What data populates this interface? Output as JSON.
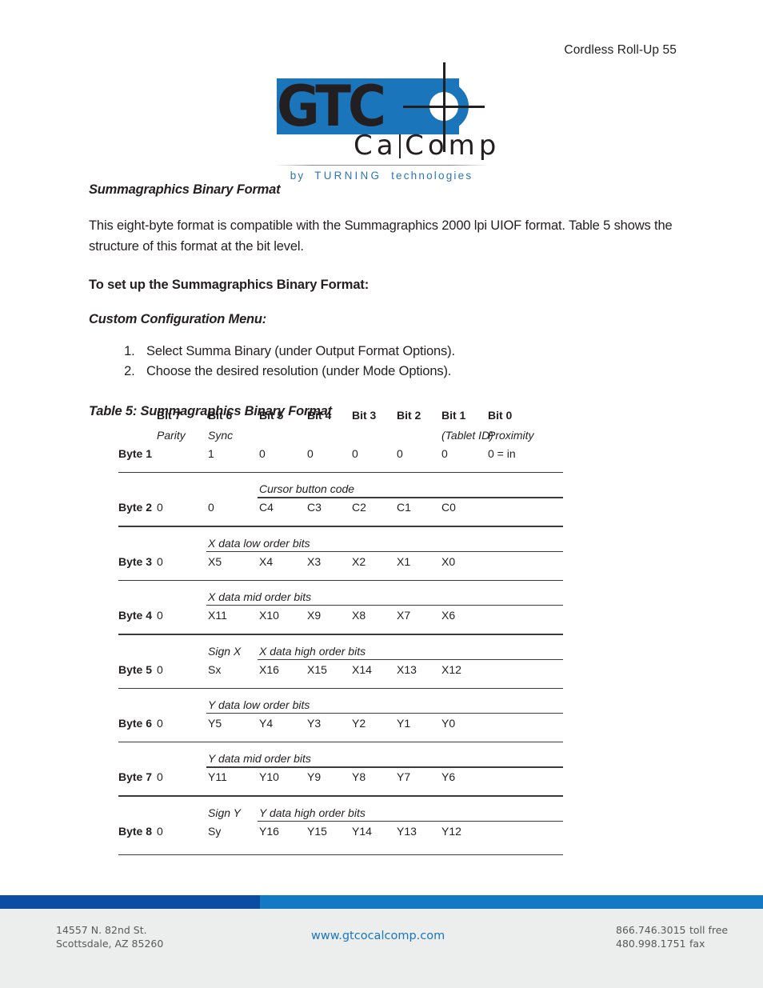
{
  "header": {
    "running_head": "Cordless Roll-Up 55"
  },
  "logo": {
    "wordmark": "GTC",
    "subwordmark_1": "Ca",
    "subwordmark_2": "Comp",
    "tagline_by": "by",
    "tagline_brand": "TURNING",
    "tagline_word": "technologies",
    "brand_blue": "#1b75bb",
    "tagline_blue": "#2e75b6"
  },
  "content": {
    "section_heading": "Summagraphics Binary Format",
    "paragraph": "This eight-byte format is compatible with the Summagraphics 2000 lpi UIOF format.  Table 5 shows the structure of this format at the bit level.",
    "setup_heading": "To set up the Summagraphics Binary Format:",
    "menu_heading": "Custom Configuration Menu:",
    "steps": [
      "Select Summa Binary (under Output Format Options).",
      "Choose the desired resolution (under Mode Options)."
    ],
    "table_caption": "Table 5: Summagraphics Binary Format"
  },
  "table": {
    "columns": [
      "Bit 7",
      "Bit 6",
      "Bit 5",
      "Bit 4",
      "Bit 3",
      "Bit 2",
      "Bit 1",
      "Bit 0"
    ],
    "header_sublabels": [
      "Parity",
      "Sync",
      "",
      "",
      "",
      "",
      "(Tablet ID)",
      "Proximity"
    ],
    "rows": [
      {
        "byte": "Byte 1",
        "group_label": "",
        "values": [
          "",
          "1",
          "0",
          "0",
          "0",
          "0",
          "0",
          "0 = in"
        ]
      },
      {
        "byte": "Byte 2",
        "group_label": "Cursor button code",
        "group_start": 2,
        "values": [
          "0",
          "0",
          "C4",
          "C3",
          "C2",
          "C1",
          "C0",
          ""
        ]
      },
      {
        "byte": "Byte 3",
        "group_label": "X data low order bits",
        "group_start": 1,
        "values": [
          "0",
          "X5",
          "X4",
          "X3",
          "X2",
          "X1",
          "X0",
          ""
        ]
      },
      {
        "byte": "Byte 4",
        "group_label": "X data mid order bits",
        "group_start": 1,
        "values": [
          "0",
          "X11",
          "X10",
          "X9",
          "X8",
          "X7",
          "X6",
          ""
        ]
      },
      {
        "byte": "Byte 5",
        "group_label": "X data high order bits",
        "sign_label": "Sign X",
        "group_start": 2,
        "values": [
          "0",
          "Sx",
          "X16",
          "X15",
          "X14",
          "X13",
          "X12",
          ""
        ]
      },
      {
        "byte": "Byte 6",
        "group_label": "Y data low order bits",
        "group_start": 1,
        "values": [
          "0",
          "Y5",
          "Y4",
          "Y3",
          "Y2",
          "Y1",
          "Y0",
          ""
        ]
      },
      {
        "byte": "Byte 7",
        "group_label": "Y data mid order bits",
        "group_start": 1,
        "values": [
          "0",
          "Y11",
          "Y10",
          "Y9",
          "Y8",
          "Y7",
          "Y6",
          ""
        ]
      },
      {
        "byte": "Byte 8",
        "group_label": "Y data high order bits",
        "sign_label": "Sign Y",
        "group_start": 2,
        "values": [
          "0",
          "Sy",
          "Y16",
          "Y15",
          "Y14",
          "Y13",
          "Y12",
          ""
        ]
      }
    ]
  },
  "footer": {
    "address_line1": "14557 N. 82nd St.",
    "address_line2": "Scottsdale, AZ 85260",
    "url": "www.gtcocalcomp.com",
    "phone_tollfree_number": "866.746.3015",
    "phone_tollfree_label": "toll free",
    "phone_fax_number": "480.998.1751",
    "phone_fax_label": "fax",
    "bar_dark": "#0b4da2",
    "bar_light": "#1479c4"
  }
}
